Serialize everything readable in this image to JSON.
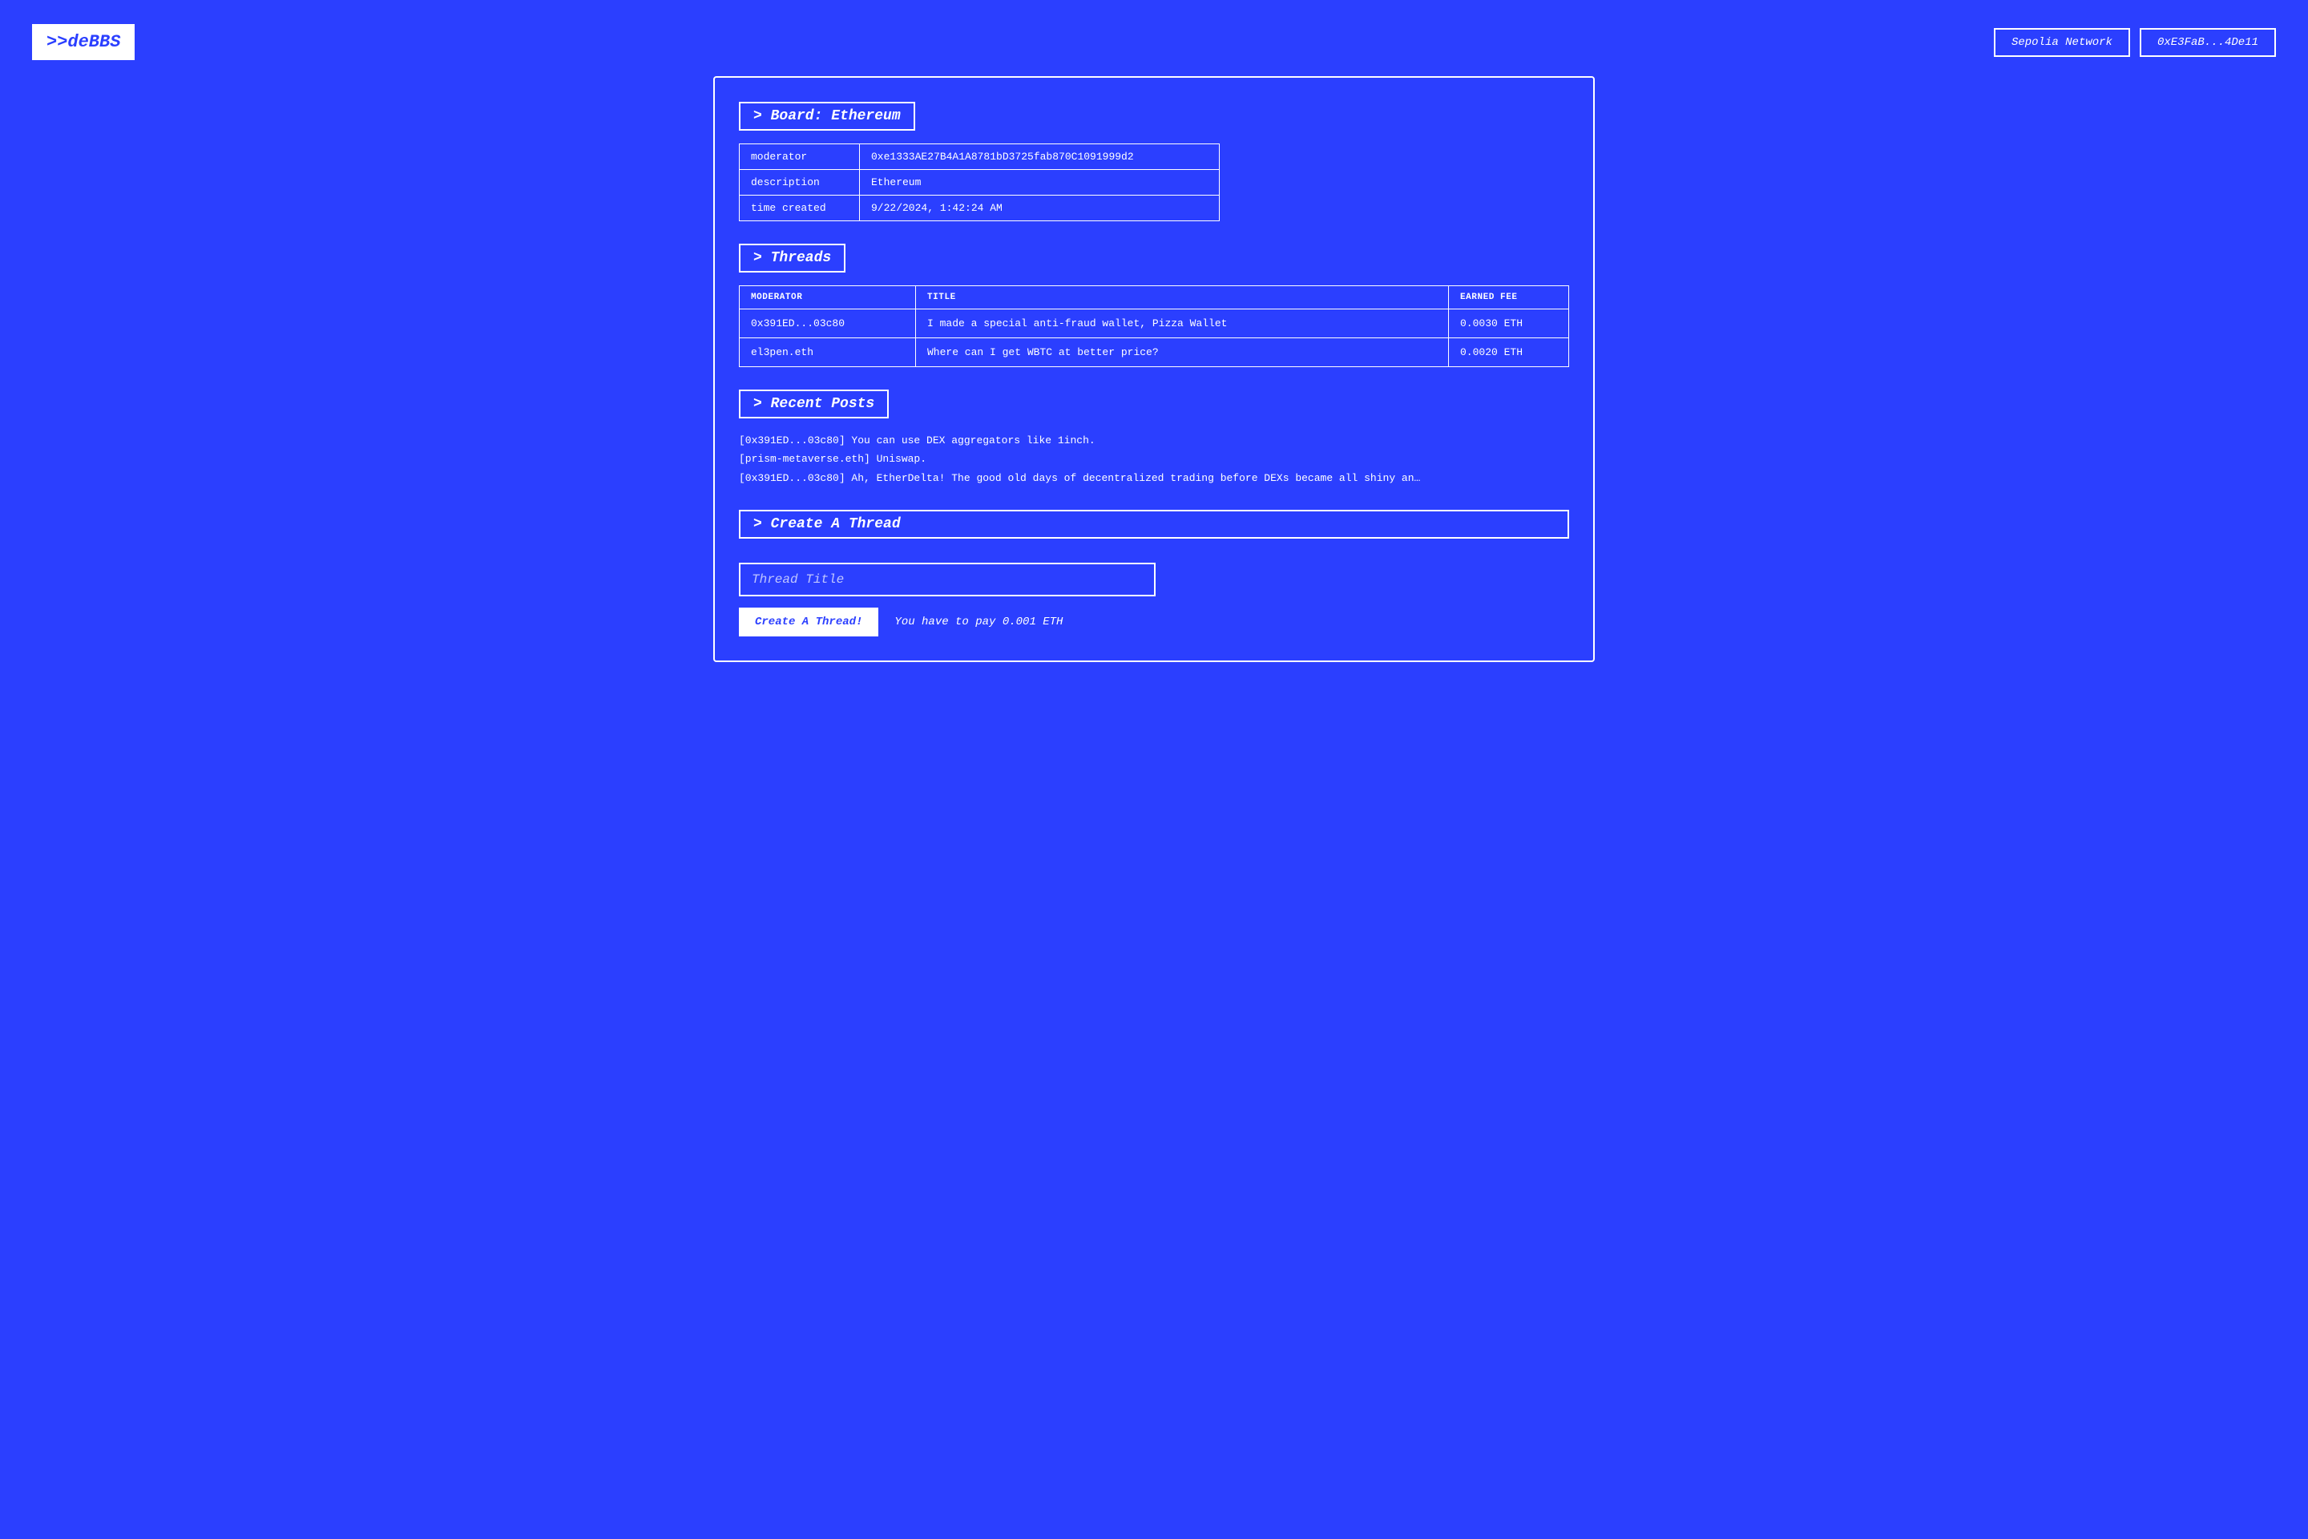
{
  "header": {
    "logo": ">>deBBS",
    "network_label": "Sepolia Network",
    "wallet_label": "0xE3FaB...4De11"
  },
  "board": {
    "section_label": "> Board: Ethereum",
    "fields": [
      {
        "key": "moderator",
        "value": "0xe1333AE27B4A1A8781bD3725fab870C1091999d2"
      },
      {
        "key": "description",
        "value": "Ethereum"
      },
      {
        "key": "time created",
        "value": "9/22/2024, 1:42:24 AM"
      }
    ]
  },
  "threads": {
    "section_label": "> Threads",
    "columns": [
      "MODERATOR",
      "TITLE",
      "EARNED FEE"
    ],
    "rows": [
      {
        "moderator": "0x391ED...03c80",
        "title": "I made a special anti-fraud wallet, Pizza Wallet",
        "fee": "0.0030 ETH"
      },
      {
        "moderator": "el3pen.eth",
        "title": "Where can I get WBTC at better price?",
        "fee": "0.0020 ETH"
      }
    ]
  },
  "recent_posts": {
    "section_label": "> Recent Posts",
    "posts": [
      "[0x391ED...03c80] You can use DEX aggregators like 1inch.",
      "[prism-metaverse.eth] Uniswap.",
      "[0x391ED...03c80] Ah, EtherDelta! The good old days of decentralized trading before DEXs became all shiny an…"
    ]
  },
  "create_thread": {
    "section_label": "> Create A Thread",
    "input_placeholder": "Thread Title",
    "button_label": "Create A Thread!",
    "fee_notice": "You have to pay 0.001 ETH"
  }
}
